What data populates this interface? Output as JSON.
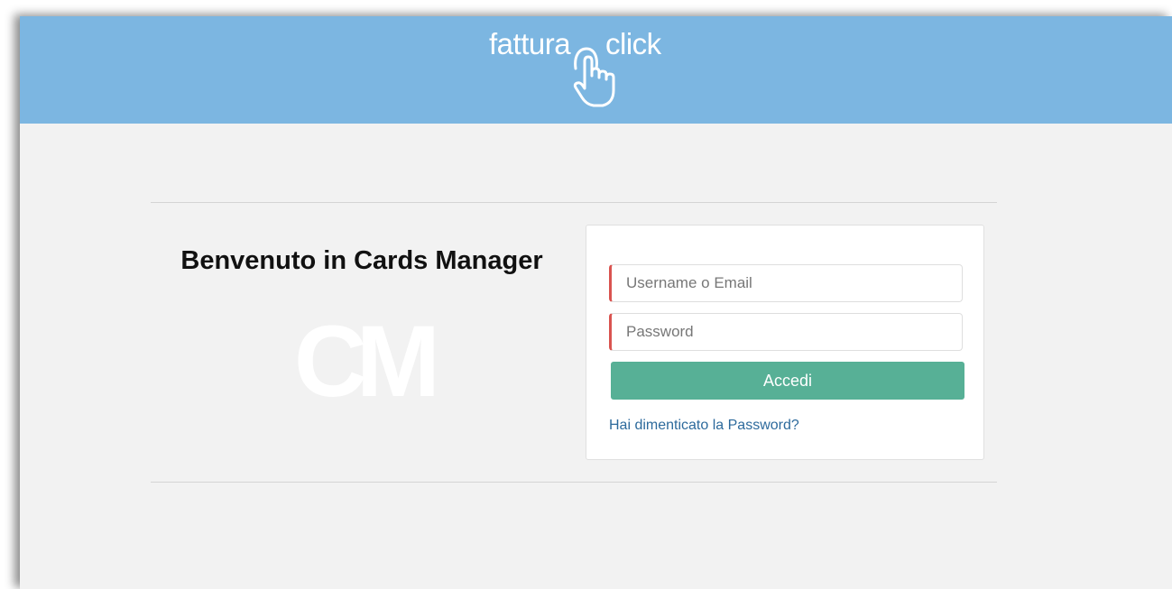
{
  "header": {
    "logo_left": "fattura",
    "logo_right": "click",
    "logo_icon": "pointing-hand-icon",
    "background_color": "#7cb6e1"
  },
  "main": {
    "welcome_title": "Benvenuto in Cards Manager",
    "watermark": "CM"
  },
  "login": {
    "username_placeholder": "Username o Email",
    "username_value": "",
    "password_placeholder": "Password",
    "password_value": "",
    "submit_label": "Accedi",
    "forgot_password_link": "Hai dimenticato la Password?",
    "button_color": "#57b096",
    "required_marker_color": "#d9534f",
    "link_color": "#2d6a9c"
  }
}
